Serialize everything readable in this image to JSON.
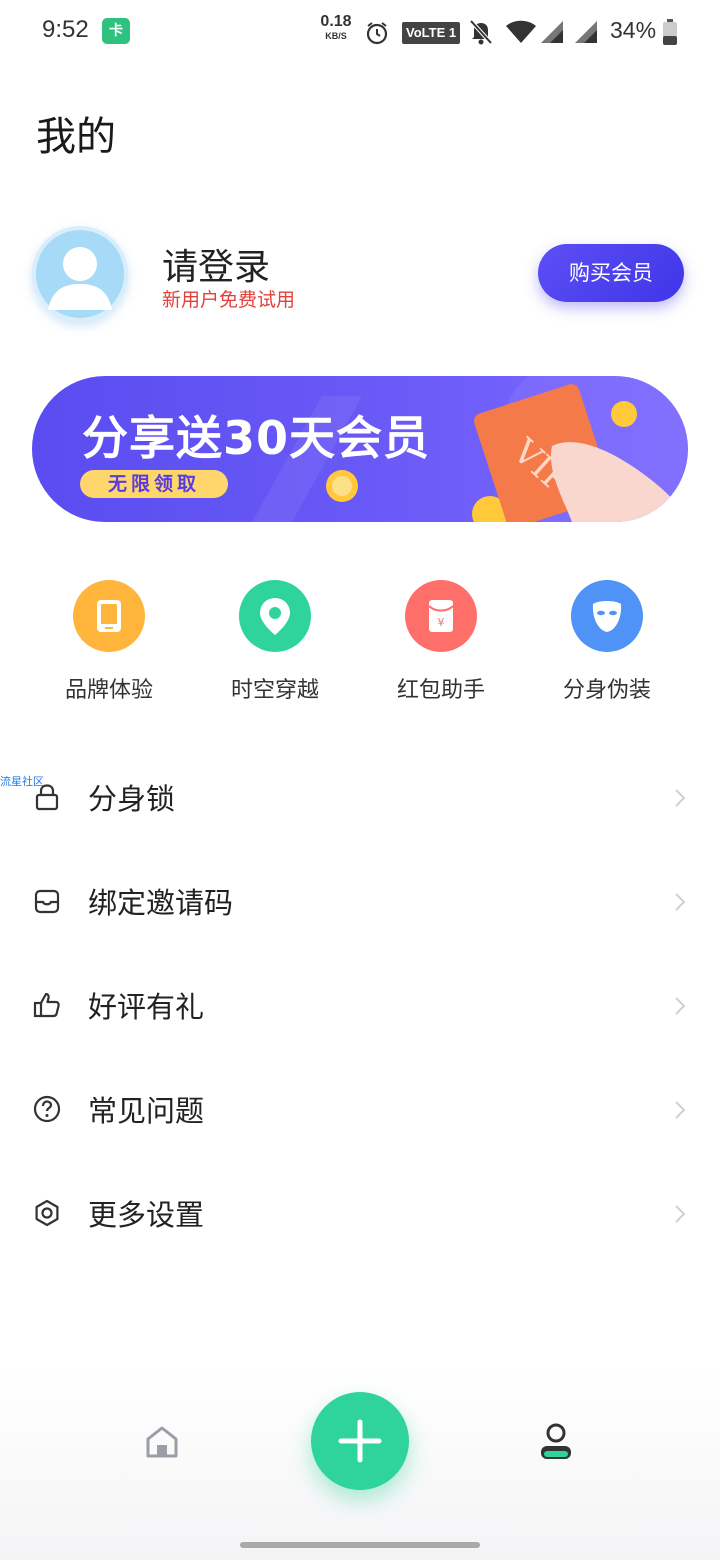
{
  "status_bar": {
    "time": "9:52",
    "app_icon_glyph": "卡",
    "net_speed_value": "0.18",
    "net_speed_unit": "KB/S",
    "volte": "VoLTE 1",
    "battery_percent": "34%",
    "icons": [
      "alarm-icon",
      "mute-icon",
      "wifi-icon",
      "signal-icon",
      "signal-icon",
      "battery-icon"
    ]
  },
  "header": {
    "title": "我的"
  },
  "profile": {
    "login_title": "请登录",
    "login_subtitle": "新用户免费试用",
    "buy_button": "购买会员",
    "subtitle_color": "#e2413b",
    "button_color": "#4a3ff0"
  },
  "banner": {
    "title": "分享送30天会员",
    "tag": "无限领取",
    "card_text": "VIP"
  },
  "features": [
    {
      "label": "品牌体验",
      "icon": "phone-icon",
      "color": "#ffb43c"
    },
    {
      "label": "时空穿越",
      "icon": "location-pin-icon",
      "color": "#2fd39c"
    },
    {
      "label": "红包助手",
      "icon": "red-envelope-icon",
      "color": "#ff6f6a"
    },
    {
      "label": "分身伪装",
      "icon": "mask-icon",
      "color": "#4e93f5"
    }
  ],
  "watermark": "流星社区",
  "menu": [
    {
      "label": "分身锁",
      "icon": "lock-icon"
    },
    {
      "label": "绑定邀请码",
      "icon": "invite-icon"
    },
    {
      "label": "好评有礼",
      "icon": "thumbs-up-icon"
    },
    {
      "label": "常见问题",
      "icon": "question-icon"
    },
    {
      "label": "更多设置",
      "icon": "settings-icon"
    }
  ],
  "bottom_nav": {
    "items": [
      "home-icon",
      "add-icon",
      "profile-icon"
    ],
    "accent": "#2fd39c"
  }
}
